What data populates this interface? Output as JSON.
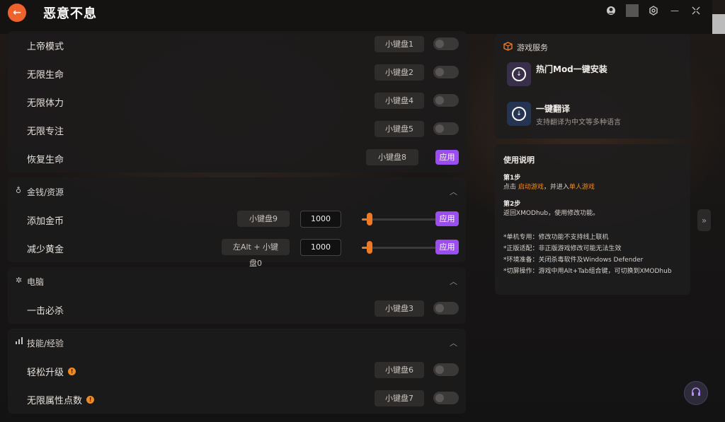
{
  "app": {
    "title": "恶意不息",
    "back_icon": "arrow-left-icon"
  },
  "window_controls": [
    "user-icon",
    "settings-icon",
    "minimize-icon",
    "shrink-icon"
  ],
  "sections": {
    "general": {
      "rows": [
        {
          "label": "上帝模式",
          "hotkey": "小键盘1",
          "enabled": false
        },
        {
          "label": "无限生命",
          "hotkey": "小键盘2",
          "enabled": false
        },
        {
          "label": "无限体力",
          "hotkey": "小键盘4",
          "enabled": false
        },
        {
          "label": "无限专注",
          "hotkey": "小键盘5",
          "enabled": false
        },
        {
          "label": "恢复生命",
          "hotkey": "小键盘8",
          "action": "应用"
        }
      ]
    },
    "money": {
      "title": "金钱/资源",
      "rows": [
        {
          "label": "添加金币",
          "hotkey": "小键盘9",
          "value": "1000",
          "action": "应用",
          "level": 0.1
        },
        {
          "label": "减少黄金",
          "hotkey": "左Alt + 小键盘0",
          "value": "1000",
          "action": "应用",
          "level": 0.1
        }
      ]
    },
    "computer": {
      "title": "电脑",
      "rows": [
        {
          "label": "一击必杀",
          "hotkey": "小键盘3",
          "enabled": false
        }
      ]
    },
    "skills": {
      "title": "技能/经验",
      "rows": [
        {
          "label": "轻松升级",
          "hotkey": "小键盘6",
          "enabled": false,
          "info": "!"
        },
        {
          "label": "无限属性点数",
          "hotkey": "小键盘7",
          "enabled": false,
          "info": "!"
        }
      ]
    }
  },
  "services": {
    "title": "游戏服务",
    "items": [
      {
        "title": "热门Mod一键安装",
        "subtitle": ""
      },
      {
        "title": "一键翻译",
        "subtitle": "支持翻译为中文等多种语言"
      }
    ]
  },
  "guide": {
    "title": "使用说明",
    "step1": {
      "label": "第1步",
      "pre": "点击 ",
      "link1": "启动游戏",
      "mid": "，并进入",
      "link2": "单人游戏"
    },
    "step2": {
      "label": "第2步",
      "text": "返回XMODhub，使用修改功能。"
    },
    "notes": [
      "*单机专用：修改功能不支持线上联机",
      "*正版适配：非正版游戏修改可能无法生效",
      "*环境准备：关闭杀毒软件及Windows Defender",
      "*切屏操作：游戏中用Alt+Tab组合键，可切换到XMODhub"
    ]
  },
  "colors": {
    "accent_orange": "#f07a24",
    "accent_purple": "#9a4ef0"
  }
}
